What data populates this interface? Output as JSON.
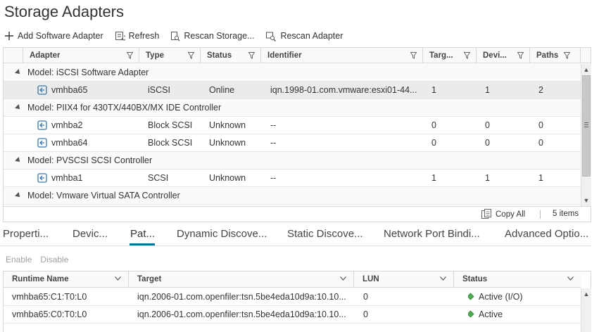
{
  "page": {
    "title": "Storage Adapters"
  },
  "toolbar": {
    "add_label": "Add Software Adapter",
    "refresh_label": "Refresh",
    "rescan_storage_label": "Rescan Storage...",
    "rescan_adapter_label": "Rescan Adapter"
  },
  "grid": {
    "columns": [
      "Adapter",
      "Type",
      "Status",
      "Identifier",
      "Targ...",
      "Devi...",
      "Paths"
    ],
    "groups": [
      {
        "label": "Model: iSCSI Software Adapter",
        "rows": [
          {
            "adapter": "vmhba65",
            "type": "iSCSI",
            "status": "Online",
            "identifier": "iqn.1998-01.com.vmware:esxi01-44...",
            "targets": "1",
            "devices": "1",
            "paths": "2"
          }
        ]
      },
      {
        "label": "Model: PIIX4 for 430TX/440BX/MX IDE Controller",
        "rows": [
          {
            "adapter": "vmhba2",
            "type": "Block SCSI",
            "status": "Unknown",
            "identifier": "--",
            "targets": "0",
            "devices": "0",
            "paths": "0"
          },
          {
            "adapter": "vmhba64",
            "type": "Block SCSI",
            "status": "Unknown",
            "identifier": "--",
            "targets": "0",
            "devices": "0",
            "paths": "0"
          }
        ]
      },
      {
        "label": "Model: PVSCSI SCSI Controller",
        "rows": [
          {
            "adapter": "vmhba1",
            "type": "SCSI",
            "status": "Unknown",
            "identifier": "--",
            "targets": "1",
            "devices": "1",
            "paths": "1"
          }
        ]
      },
      {
        "label": "Model: Vmware Virtual SATA Controller",
        "rows": []
      }
    ],
    "footer": {
      "copy_all": "Copy All",
      "count": "5 items"
    }
  },
  "tabs": [
    "Properti...",
    "Devic...",
    "Pat...",
    "Dynamic Discove...",
    "Static Discove...",
    "Network Port Bindi...",
    "Advanced Optio..."
  ],
  "active_tab": "Pat...",
  "path_actions": {
    "enable": "Enable",
    "disable": "Disable"
  },
  "paths_grid": {
    "columns": [
      "Runtime Name",
      "Target",
      "LUN",
      "Status"
    ],
    "rows": [
      {
        "runtime_name": "vmhba65:C1:T0:L0",
        "target": "iqn.2006-01.com.openfiler:tsn.5be4eda10d9a:10.10...",
        "lun": "0",
        "status": "Active (I/O)"
      },
      {
        "runtime_name": "vmhba65:C0:T0:L0",
        "target": "iqn.2006-01.com.openfiler:tsn.5be4eda10d9a:10.10...",
        "lun": "0",
        "status": "Active"
      }
    ]
  },
  "colors": {
    "accent": "#0072a3",
    "active_status": "#4caf50",
    "selected_row": "#ebebeb"
  }
}
